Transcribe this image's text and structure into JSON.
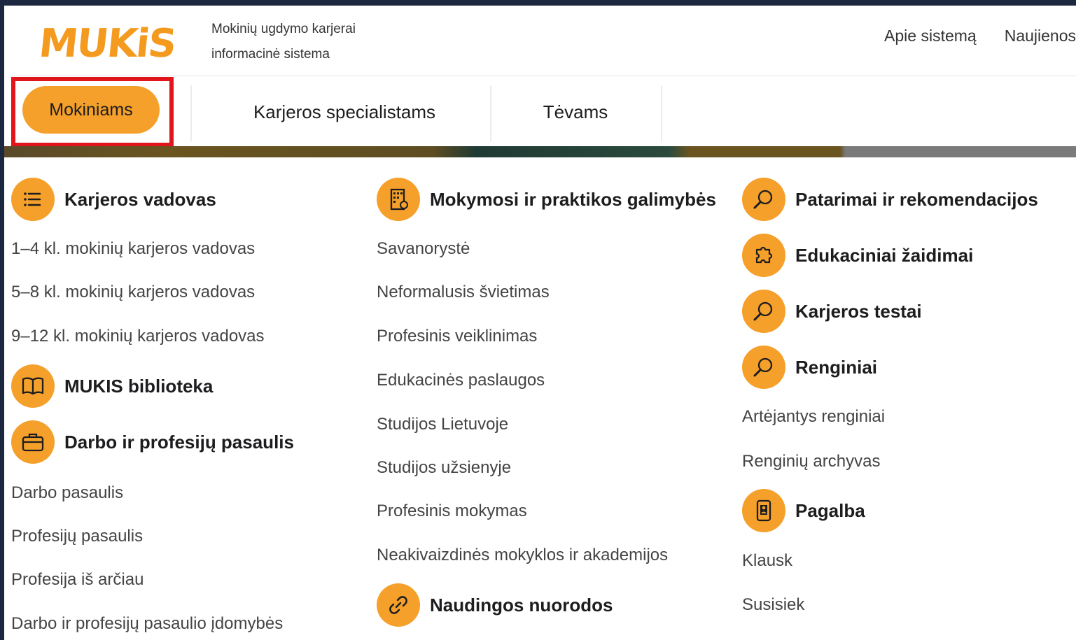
{
  "header": {
    "logo_text": "MUKiS",
    "tagline_line1": "Mokinių ugdymo karjerai",
    "tagline_line2": "informacinė sistema",
    "nav": [
      "Apie sistemą",
      "Naujienos"
    ]
  },
  "tabs": {
    "active": "Mokiniams",
    "items": [
      "Karjeros specialistams",
      "Tėvams"
    ]
  },
  "colors": {
    "accent": "#f5a02a",
    "highlight_border": "#e1161d"
  },
  "menu": {
    "col1": {
      "karjeros_vadovas": {
        "title": "Karjeros vadovas",
        "icon": "list-icon",
        "links": [
          "1–4 kl. mokinių karjeros vadovas",
          "5–8 kl. mokinių karjeros vadovas",
          "9–12 kl. mokinių karjeros vadovas"
        ]
      },
      "biblioteka": {
        "title": "MUKIS biblioteka",
        "icon": "book-icon"
      },
      "darbo": {
        "title": "Darbo ir profesijų pasaulis",
        "icon": "briefcase-icon",
        "links": [
          "Darbo pasaulis",
          "Profesijų pasaulis",
          "Profesija iš arčiau",
          "Darbo ir profesijų pasaulio įdomybės"
        ]
      }
    },
    "col2": {
      "mokymosi": {
        "title": "Mokymosi ir praktikos galimybės",
        "icon": "building-icon",
        "links": [
          "Savanorystė",
          "Neformalusis švietimas",
          "Profesinis veiklinimas",
          "Edukacinės paslaugos",
          "Studijos Lietuvoje",
          "Studijos užsienyje",
          "Profesinis mokymas",
          "Neakivaizdinės mokyklos ir akademijos"
        ]
      },
      "nuorodos": {
        "title": "Naudingos nuorodos",
        "icon": "link-icon"
      }
    },
    "col3": {
      "patarimai": {
        "title": "Patarimai ir rekomendacijos",
        "icon": "magnifier-icon"
      },
      "zaidimai": {
        "title": "Edukaciniai žaidimai",
        "icon": "puzzle-icon"
      },
      "testai": {
        "title": "Karjeros testai",
        "icon": "magnifier-icon"
      },
      "renginiai": {
        "title": "Renginiai",
        "icon": "magnifier-icon",
        "links": [
          "Artėjantys renginiai",
          "Renginių archyvas"
        ]
      },
      "pagalba": {
        "title": "Pagalba",
        "icon": "phone-icon",
        "links": [
          "Klausk",
          "Susisiek"
        ]
      }
    }
  }
}
